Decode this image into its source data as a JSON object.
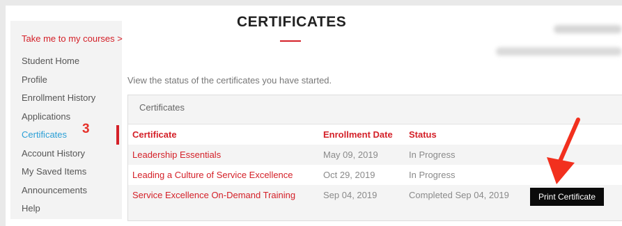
{
  "sidebar": {
    "courses_link": "Take me to my courses >",
    "items": [
      {
        "label": "Student Home"
      },
      {
        "label": "Profile"
      },
      {
        "label": "Enrollment History"
      },
      {
        "label": "Applications"
      },
      {
        "label": "Certificates"
      },
      {
        "label": "Account History"
      },
      {
        "label": "My Saved Items"
      },
      {
        "label": "Announcements"
      },
      {
        "label": "Help"
      }
    ],
    "active_index": 4
  },
  "annotation": {
    "step_number": "3"
  },
  "header": {
    "title": "CERTIFICATES"
  },
  "intro_text": "View the status of the certificates you have started.",
  "panel": {
    "title": "Certificates",
    "columns": [
      "Certificate",
      "Enrollment Date",
      "Status"
    ],
    "rows": [
      {
        "certificate": "Leadership Essentials",
        "date": "May 09, 2019",
        "status": "In Progress"
      },
      {
        "certificate": "Leading a Culture of Service Excellence",
        "date": "Oct 29, 2019",
        "status": "In Progress"
      },
      {
        "certificate": "Service Excellence On-Demand Training",
        "date": "Sep 04, 2019",
        "status": "Completed Sep 04, 2019",
        "action": "Print Certificate"
      }
    ]
  },
  "colors": {
    "accent": "#d42028",
    "link_active": "#2a9fd6",
    "annotation": "#e6312a"
  }
}
